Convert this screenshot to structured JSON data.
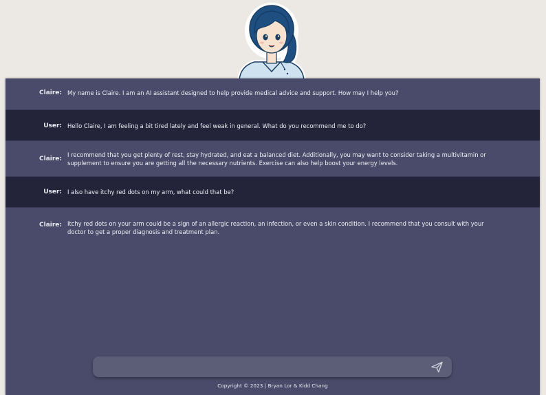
{
  "avatar": {
    "icon": "nurse-avatar-icon"
  },
  "messages": [
    {
      "speaker": "Claire:",
      "role": "assistant",
      "text": "My name is Claire. I am an AI assistant designed to help provide medical advice and support. How may I help you?"
    },
    {
      "speaker": "User:",
      "role": "user",
      "text": "Hello Claire, I am feeling a bit tired lately and feel weak in general. What do you recommend me to do?"
    },
    {
      "speaker": "Claire:",
      "role": "assistant",
      "text": "I recommend that you get plenty of rest, stay hydrated, and eat a balanced diet. Additionally, you may want to consider taking a multivitamin or supplement to ensure you are getting all the necessary nutrients. Exercise can also help boost your energy levels."
    },
    {
      "speaker": "User:",
      "role": "user",
      "text": "I also have itchy red dots on my arm, what could that be?"
    },
    {
      "speaker": "Claire:",
      "role": "assistant",
      "text": "Itchy red dots on your arm could be a sign of an allergic reaction, an infection, or even a skin condition. I recommend that you consult with your doctor to get a proper diagnosis and treatment plan."
    }
  ],
  "input": {
    "value": "",
    "placeholder": "",
    "send_icon": "send-icon"
  },
  "footer": {
    "text": "Copyright © 2023 | Bryan Lor & Kidd Chang"
  },
  "colors": {
    "page_bg": "#ece8e3",
    "panel_bg": "#4a4b6a",
    "user_row_bg": "#23233a",
    "input_bg": "#5c5d77",
    "avatar_hair": "#1e4f80",
    "avatar_uniform": "#cfe2ef"
  }
}
